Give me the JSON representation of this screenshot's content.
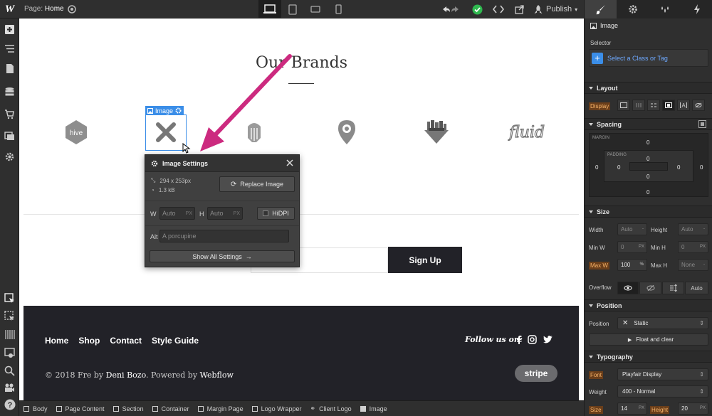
{
  "topbar": {
    "page_label": "Page:",
    "page_name": "Home",
    "publish_label": "Publish"
  },
  "canvas": {
    "section_title": "Our Brands",
    "brand_logos": [
      "hive",
      "placeholder",
      "helmet",
      "pin",
      "badge",
      "fluid"
    ],
    "selection_tag": "Image",
    "signup_button": "Sign Up",
    "footer": {
      "nav": [
        "Home",
        "Shop",
        "Contact",
        "Style Guide"
      ],
      "follow_label": "Follow us on:",
      "copyright_prefix": "© 2018 Fre by",
      "author": "Deni Bozo",
      "powered_text": ". Powered by",
      "powered_by": "Webflow",
      "stripe_badge": "stripe"
    }
  },
  "popup": {
    "title": "Image Settings",
    "dimensions": "294 x 253px",
    "filesize": "1.3 kB",
    "replace_label": "Replace Image",
    "w_label": "W",
    "w_placeholder": "Auto",
    "h_label": "H",
    "h_placeholder": "Auto",
    "unit": "PX",
    "hidpi_label": "HiDPI",
    "alt_label": "Alt",
    "alt_placeholder": "A porcupine",
    "show_all_label": "Show All Settings"
  },
  "panel": {
    "element_title": "Image",
    "selector_label": "Selector",
    "selector_placeholder": "Select a Class or Tag",
    "layout": {
      "title": "Layout",
      "display_label": "Display"
    },
    "spacing": {
      "title": "Spacing",
      "margin_label": "MARGIN",
      "padding_label": "PADDING",
      "margin": {
        "top": "0",
        "right": "0",
        "bottom": "0",
        "left": "0"
      },
      "padding": {
        "top": "0",
        "right": "0",
        "bottom": "0",
        "left": "0"
      }
    },
    "size": {
      "title": "Size",
      "width_label": "Width",
      "width_value": "Auto",
      "height_label": "Height",
      "height_value": "Auto",
      "min_w_label": "Min W",
      "min_w_value": "0",
      "min_h_label": "Min H",
      "min_h_value": "0",
      "max_w_label": "Max W",
      "max_w_value": "100",
      "max_w_unit": "%",
      "max_h_label": "Max H",
      "max_h_value": "None",
      "unit": "PX",
      "overflow_label": "Overflow",
      "overflow_auto": "Auto"
    },
    "position": {
      "title": "Position",
      "position_label": "Position",
      "position_value": "Static",
      "float_label": "Float and clear"
    },
    "typography": {
      "title": "Typography",
      "font_label": "Font",
      "font_value": "Playfair Display",
      "weight_label": "Weight",
      "weight_value": "400 - Normal",
      "size_label": "Size",
      "size_value": "14",
      "height_label": "Height",
      "height_value": "20",
      "unit": "PX"
    }
  },
  "breadcrumbs": [
    "Body",
    "Page Content",
    "Section",
    "Container",
    "Margin Page",
    "Logo Wrapper",
    "Client Logo",
    "Image"
  ],
  "colors": {
    "accent": "#3b8ee8",
    "arrow": "#cc2a7f",
    "orange": "#f7a24a",
    "success": "#2fb84f"
  }
}
